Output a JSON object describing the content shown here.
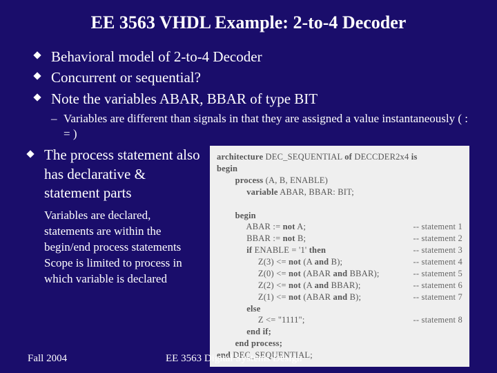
{
  "title": "EE 3563 VHDL Example: 2-to-4 Decoder",
  "bullets": [
    "Behavioral model of 2-to-4 Decoder",
    "Concurrent or sequential?",
    "Note the variables ABAR, BBAR of type BIT"
  ],
  "subbullet": "Variables are different than signals in that they are assigned a value instantaneously ( : = )",
  "bullet4_main": "The process statement also has declarative & statement parts",
  "bullet4_sub": "Variables are declared, statements are within the begin/end process statements  Scope is limited to process in which variable is declared",
  "code": {
    "l1a": "architecture",
    "l1b": " DEC_SEQUENTIAL ",
    "l1c": "of",
    "l1d": " DECCDER2x4 ",
    "l1e": "is",
    "l2": "begin",
    "l3a": "process",
    "l3b": " (A, B, ENABLE)",
    "l4a": "variable",
    "l4b": " ABAR, BBAR: BIT;",
    "l5": "begin",
    "l6": "ABAR := ",
    "l6b": "not",
    "l6c": " A;",
    "c1": "-- statement 1",
    "l7": "BBAR := ",
    "l7b": "not",
    "l7c": " B;",
    "c2": "-- statement 2",
    "l8a": "if",
    "l8b": " ENABLE = '1' ",
    "l8c": "then",
    "c3": "-- statement 3",
    "l9": "Z(3) <= ",
    "l9b": "not",
    "l9c": " (A ",
    "l9d": "and",
    "l9e": " B);",
    "c4": "-- statement 4",
    "l10": "Z(0) <= ",
    "l10b": "not",
    "l10c": " (ABAR ",
    "l10d": "and",
    "l10e": " BBAR);",
    "c5": "-- statement 5",
    "l11": "Z(2) <= ",
    "l11b": "not",
    "l11c": " (A ",
    "l11d": "and",
    "l11e": " BBAR);",
    "c6": "-- statement 6",
    "l12": "Z(1) <= ",
    "l12b": "not",
    "l12c": " (ABAR ",
    "l12d": "and",
    "l12e": " B);",
    "c7": "-- statement 7",
    "l13": "else",
    "l14": "Z <= \"1111\";",
    "c8": "-- statement 8",
    "l15": "end if;",
    "l16": "end process;",
    "l17a": "end",
    "l17b": " DEC_SEQUENTIAL;"
  },
  "footer": {
    "left": "Fall 2004",
    "center": "EE 3563 Digital Systems Design"
  }
}
